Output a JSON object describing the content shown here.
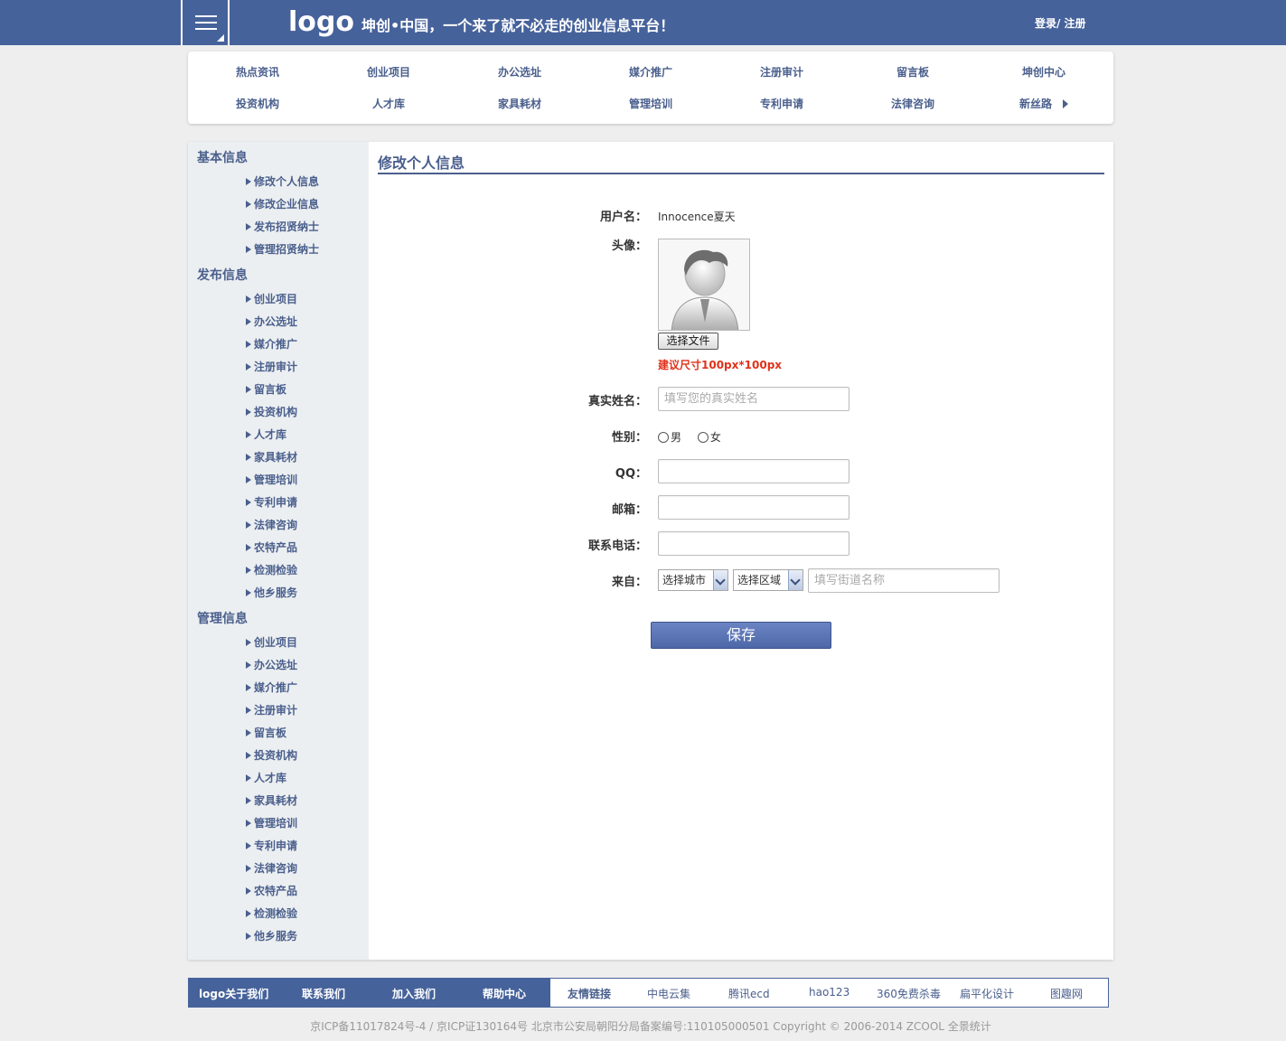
{
  "header": {
    "logo": "logo",
    "slogan": "坤创•中国，一个来了就不必走的创业信息平台！",
    "auth": "登录/ 注册"
  },
  "catnav": {
    "row1": [
      "热点资讯",
      "创业项目",
      "办公选址",
      "媒介推广",
      "注册审计",
      "留言板",
      "坤创中心"
    ],
    "row2": [
      "投资机构",
      "人才库",
      "家具耗材",
      "管理培训",
      "专利申请",
      "法律咨询",
      "新丝路"
    ]
  },
  "sidebar": {
    "groups": [
      {
        "title": "基本信息",
        "items": [
          "修改个人信息",
          "修改企业信息",
          "发布招贤纳士",
          "管理招贤纳士"
        ]
      },
      {
        "title": "发布信息",
        "items": [
          "创业项目",
          "办公选址",
          "媒介推广",
          "注册审计",
          "留言板",
          "投资机构",
          "人才库",
          "家具耗材",
          "管理培训",
          "专利申请",
          "法律咨询",
          "农特产品",
          "检测检验",
          "他乡服务"
        ]
      },
      {
        "title": "管理信息",
        "items": [
          "创业项目",
          "办公选址",
          "媒介推广",
          "注册审计",
          "留言板",
          "投资机构",
          "人才库",
          "家具耗材",
          "管理培训",
          "专利申请",
          "法律咨询",
          "农特产品",
          "检测检验",
          "他乡服务"
        ]
      }
    ]
  },
  "form": {
    "title": "修改个人信息",
    "username_label": "用户名：",
    "username_value": "Innocence夏天",
    "avatar_label": "头像：",
    "file_button": "选择文件",
    "avatar_hint": "建议尺寸100px*100px",
    "realname_label": "真实姓名：",
    "realname_placeholder": "填写您的真实姓名",
    "gender_label": "性别：",
    "gender_male": "男",
    "gender_female": "女",
    "qq_label": "QQ：",
    "email_label": "邮箱：",
    "phone_label": "联系电话：",
    "from_label": "来自：",
    "city_select": "选择城市",
    "district_select": "选择区域",
    "street_placeholder": "填写街道名称",
    "save_button": "保存"
  },
  "footer": {
    "left_links": [
      "logo关于我们",
      "联系我们",
      "加入我们",
      "帮助中心"
    ],
    "friend_title": "友情链接",
    "right_links": [
      "中电云集",
      "腾讯ecd",
      "hao123",
      "360免费杀毒",
      "扁平化设计",
      "图趣网"
    ],
    "copyright": "京ICP备11017824号-4 / 京ICP证130164号 北京市公安局朝阳分局备案编号:110105000501 Copyright © 2006-2014 ZCOOL 全景统计"
  },
  "colors": {
    "brand": "#46629b",
    "link": "#4a5f8d",
    "hint": "#e0321a"
  }
}
